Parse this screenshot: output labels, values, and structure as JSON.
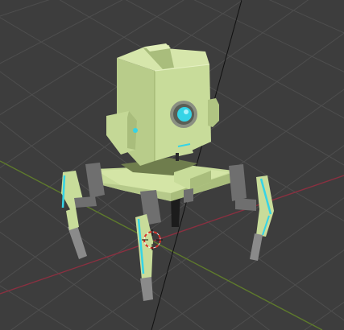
{
  "viewport": {
    "mode": "3d-viewport",
    "colors": {
      "background": "#3d3d3d",
      "grid": "#4e4e4e",
      "x_axis": "#8a3040",
      "y_axis": "#5e7a2c",
      "model_base": "#c8dc9a",
      "model_light": "#d9e8ae",
      "model_shade": "#a9bd7c",
      "model_dark": "#8fa266",
      "joint_grey": "#6f6f6f",
      "glow_cyan": "#35d4e6",
      "selection_line": "#111111",
      "cursor_red": "#d8322a"
    },
    "objects": [
      {
        "name": "robot-body",
        "shape": "cube"
      },
      {
        "name": "robot-eye",
        "shape": "ring",
        "glow": true
      },
      {
        "name": "robot-leg",
        "count": 4,
        "glow": true
      }
    ],
    "gizmos": {
      "3d-cursor": true,
      "grid": true
    }
  }
}
